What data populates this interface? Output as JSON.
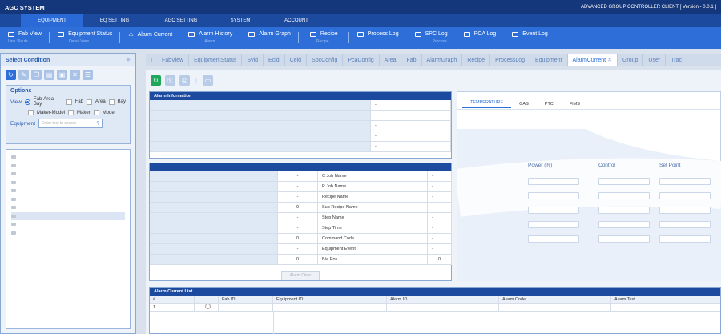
{
  "app": {
    "title": "AGC SYSTEM",
    "version": "ADVANCED GROUP CONTROLLER CLIENT [ Version - 0.0.1 ]"
  },
  "menu": [
    "EQUIPMENT",
    "EQ SETTING",
    "AGC SETTING",
    "SYSTEM",
    "ACCOUNT"
  ],
  "toolbar": [
    {
      "label": "Fab View",
      "sub": "Line Slauts",
      "icon": "monitor-icon"
    },
    {
      "label": "Equipment Status",
      "sub": "Detail View",
      "icon": "equipment-icon"
    },
    {
      "label": "Alarm Current",
      "sub": "Alarm",
      "icon": "warning-icon"
    },
    {
      "label": "Alarm History",
      "sub": "",
      "icon": "history-icon"
    },
    {
      "label": "Alarm Graph",
      "sub": "",
      "icon": "graph-icon"
    },
    {
      "label": "Recipe",
      "sub": "Recipe",
      "icon": "recipe-icon"
    },
    {
      "label": "Process Log",
      "sub": "",
      "icon": "log-icon"
    },
    {
      "label": "SPC Log",
      "sub": "Process",
      "icon": "log-icon"
    },
    {
      "label": "PCA Log",
      "sub": "",
      "icon": "log-icon"
    },
    {
      "label": "Event Log",
      "sub": "",
      "icon": "log-icon"
    }
  ],
  "left": {
    "title": "Select Condition",
    "options_title": "Options",
    "view_label": "View",
    "view_options": [
      "Fab-Area-Bay",
      "Fab",
      "Area",
      "Bay",
      "Maker-Model",
      "Maker",
      "Model"
    ],
    "equipment_label": "Equipment",
    "equipment_placeholder": "Enter text to search"
  },
  "tabs": [
    "FabView",
    "EquipmentStatus",
    "Svid",
    "Ecid",
    "Ceid",
    "SpcConfig",
    "PcaConfig",
    "Area",
    "Fab",
    "AlarmGraph",
    "Recipe",
    "ProcessLog",
    "Equipment",
    "AlarmCurrent",
    "Group",
    "User",
    "Trac"
  ],
  "alarm_info": {
    "title": "Alarm Information",
    "values": [
      "-",
      "-",
      "-",
      "-",
      "-"
    ]
  },
  "job_info": {
    "left_values": [
      "-",
      "-",
      "-",
      "0",
      "-",
      "-",
      "0",
      "-",
      "0"
    ],
    "right_labels": [
      "C Job Name",
      "P Job Name",
      "Recipe Name",
      "Sub Recipe Name",
      "Step Name",
      "Step Time",
      "Command Code",
      "Equipment Event",
      "B/e Pos"
    ],
    "right_values": [
      "-",
      "-",
      "-",
      "-",
      "-",
      "-",
      "-",
      "-",
      "0"
    ],
    "button": "Alarm Clear"
  },
  "right_panel": {
    "tabs": [
      "TEMPERATURE",
      "GAS",
      "PTC",
      "FIMS"
    ],
    "columns": [
      "Power (%)",
      "Control",
      "Set Point"
    ]
  },
  "alarm_list": {
    "title": "Alarm Current List",
    "columns": [
      "#",
      "",
      "Fab ID",
      "Equipment ID",
      "Alarm ID",
      "Alarm Code",
      "Alarm Text"
    ],
    "rows": [
      [
        "1"
      ]
    ]
  }
}
